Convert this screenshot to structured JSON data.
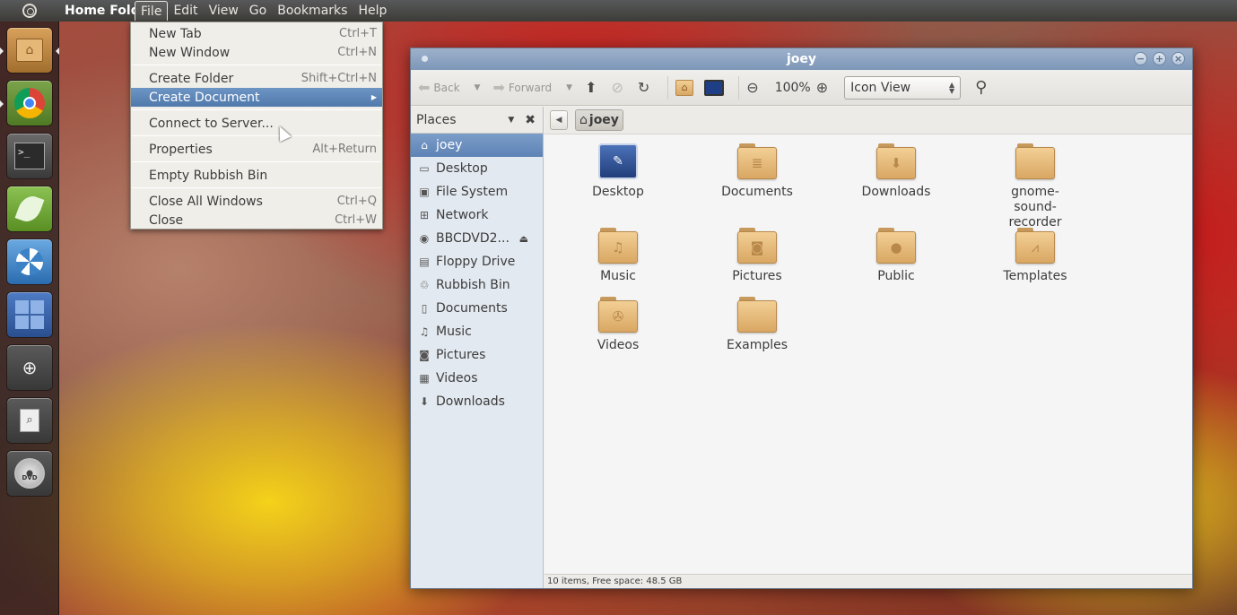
{
  "top_panel": {
    "app_title": "Home Folder",
    "menus": [
      "File",
      "Edit",
      "View",
      "Go",
      "Bookmarks",
      "Help"
    ]
  },
  "launcher": {
    "items": [
      {
        "name": "home-folder",
        "icon": "home-folder-icon"
      },
      {
        "name": "chrome",
        "icon": "chrome-icon"
      },
      {
        "name": "terminal",
        "icon": "terminal-icon",
        "glyph": ">_"
      },
      {
        "name": "leafpad",
        "icon": "leaf-icon"
      },
      {
        "name": "shutter",
        "icon": "shutter-icon"
      },
      {
        "name": "workspace-switcher",
        "icon": "workspace-icon"
      },
      {
        "name": "magnifier",
        "icon": "magnifier-icon"
      },
      {
        "name": "document-viewer",
        "icon": "document-search-icon"
      },
      {
        "name": "dvd",
        "icon": "dvd-icon",
        "glyph": "DVD"
      }
    ]
  },
  "file_menu": {
    "items": [
      {
        "label": "New Tab",
        "accel": "Ctrl+T"
      },
      {
        "label": "New Window",
        "accel": "Ctrl+N"
      },
      {
        "label": "Create Folder",
        "accel": "Shift+Ctrl+N"
      },
      {
        "label": "Create Document",
        "accel": ""
      },
      {
        "label": "Connect to Server...",
        "accel": ""
      },
      {
        "label": "Properties",
        "accel": "Alt+Return"
      },
      {
        "label": "Empty Rubbish Bin",
        "accel": ""
      },
      {
        "label": "Close All Windows",
        "accel": "Ctrl+Q"
      },
      {
        "label": "Close",
        "accel": "Ctrl+W"
      }
    ]
  },
  "window": {
    "title": "joey",
    "toolbar": {
      "back": "Back",
      "forward": "Forward",
      "zoom": "100%",
      "view_mode": "Icon View"
    },
    "places": {
      "heading": "Places",
      "items": [
        {
          "label": "joey",
          "icon": "home-icon",
          "glyph": "⌂"
        },
        {
          "label": "Desktop",
          "icon": "desktop-icon",
          "glyph": "▭"
        },
        {
          "label": "File System",
          "icon": "harddisk-icon",
          "glyph": "▣"
        },
        {
          "label": "Network",
          "icon": "network-icon",
          "glyph": "⊞"
        },
        {
          "label": "BBCDVD2...",
          "icon": "dvd-icon",
          "glyph": "◉"
        },
        {
          "label": "Floppy Drive",
          "icon": "floppy-icon",
          "glyph": "▤"
        },
        {
          "label": "Rubbish Bin",
          "icon": "trash-icon",
          "glyph": "♲"
        },
        {
          "label": "Documents",
          "icon": "documents-icon",
          "glyph": "▯"
        },
        {
          "label": "Music",
          "icon": "music-icon",
          "glyph": "♫"
        },
        {
          "label": "Pictures",
          "icon": "camera-icon",
          "glyph": "◙"
        },
        {
          "label": "Videos",
          "icon": "film-icon",
          "glyph": "▦"
        },
        {
          "label": "Downloads",
          "icon": "download-icon",
          "glyph": "⬇"
        }
      ]
    },
    "path": {
      "crumb": "joey"
    },
    "files": [
      {
        "label": "Desktop",
        "icon": "desktop-folder-icon",
        "glyph": "✎"
      },
      {
        "label": "Documents",
        "icon": "documents-folder-icon",
        "glyph": "≣"
      },
      {
        "label": "Downloads",
        "icon": "downloads-folder-icon",
        "glyph": "⬇"
      },
      {
        "label": "gnome-sound-recorder",
        "icon": "folder-icon",
        "glyph": ""
      },
      {
        "label": "Music",
        "icon": "music-folder-icon",
        "glyph": "♫"
      },
      {
        "label": "Pictures",
        "icon": "pictures-folder-icon",
        "glyph": "◙"
      },
      {
        "label": "Public",
        "icon": "public-folder-icon",
        "glyph": "●"
      },
      {
        "label": "Templates",
        "icon": "templates-folder-icon",
        "glyph": "⩘"
      },
      {
        "label": "Videos",
        "icon": "videos-folder-icon",
        "glyph": "✇"
      },
      {
        "label": "Examples",
        "icon": "folder-icon",
        "glyph": ""
      }
    ],
    "status": "10 items, Free space: 48.5 GB"
  }
}
